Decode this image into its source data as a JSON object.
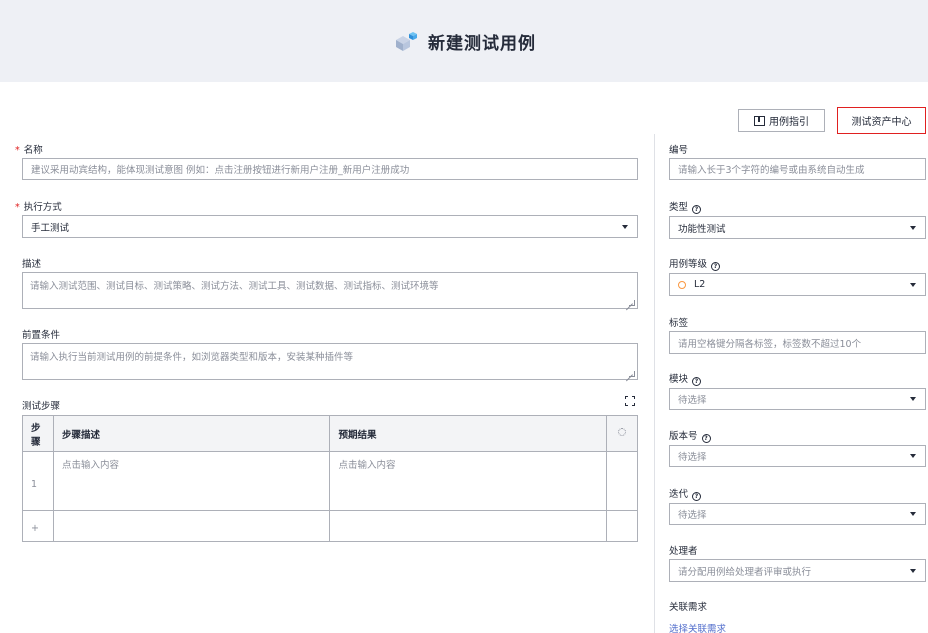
{
  "header": {
    "title": "新建测试用例",
    "logo_icon": "cube-logo-icon"
  },
  "toolbar": {
    "guide_label": "用例指引",
    "asset_center_label": "测试资产中心"
  },
  "left": {
    "name": {
      "label": "名称",
      "placeholder": "建议采用动宾结构，能体现测试意图 例如：点击注册按钮进行新用户注册_新用户注册成功"
    },
    "exec_mode": {
      "label": "执行方式",
      "value": "手工测试"
    },
    "description": {
      "label": "描述",
      "placeholder": "请输入测试范围、测试目标、测试策略、测试方法、测试工具、测试数据、测试指标、测试环境等"
    },
    "precondition": {
      "label": "前置条件",
      "placeholder": "请输入执行当前测试用例的前提条件，如浏览器类型和版本，安装某种插件等"
    },
    "steps": {
      "label": "测试步骤",
      "columns": [
        "步骤",
        "步骤描述",
        "预期结果"
      ],
      "rows": [
        {
          "num": "1",
          "desc": "点击输入内容",
          "expected": "点击输入内容"
        },
        {
          "num": "+",
          "desc": "",
          "expected": ""
        }
      ]
    }
  },
  "right": {
    "number": {
      "label": "编号",
      "placeholder": "请输入长于3个字符的编号或由系统自动生成"
    },
    "type": {
      "label": "类型",
      "value": "功能性测试"
    },
    "level": {
      "label": "用例等级",
      "value": "L2",
      "color": "#fa9841"
    },
    "tags": {
      "label": "标签",
      "placeholder": "请用空格键分隔各标签，标签数不超过10个"
    },
    "module": {
      "label": "模块",
      "placeholder": "待选择"
    },
    "version": {
      "label": "版本号",
      "placeholder": "待选择"
    },
    "iteration": {
      "label": "迭代",
      "placeholder": "待选择"
    },
    "handler": {
      "label": "处理者",
      "placeholder": "请分配用例给处理者评审或执行"
    },
    "requirement": {
      "label": "关联需求",
      "link": "选择关联需求"
    }
  },
  "colors": {
    "required": "#e02020",
    "link": "#526ecc",
    "highlight_border": "#e02020"
  }
}
